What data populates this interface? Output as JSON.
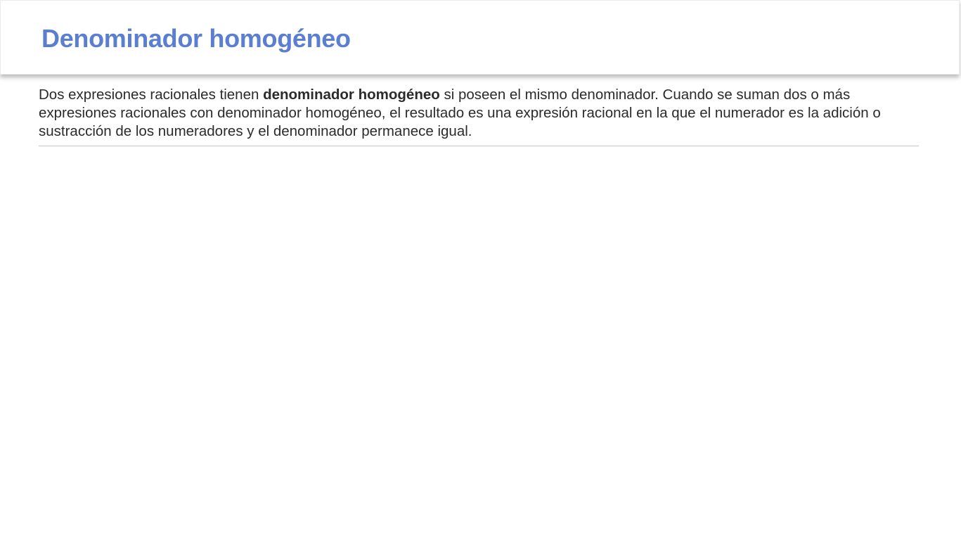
{
  "header": {
    "title": "Denominador homogéneo",
    "title_color": "#5a7fd0"
  },
  "content": {
    "paragraph_before": "Dos expresiones racionales tienen ",
    "paragraph_bold": "denominador homogéneo",
    "paragraph_after": " si poseen el mismo denominador. Cuando se suman dos o más expresiones racionales con denominador homogéneo, el resultado es una expresión racional en la que el numerador es la adición o sustracción de los numeradores y el denominador permanece igual."
  }
}
